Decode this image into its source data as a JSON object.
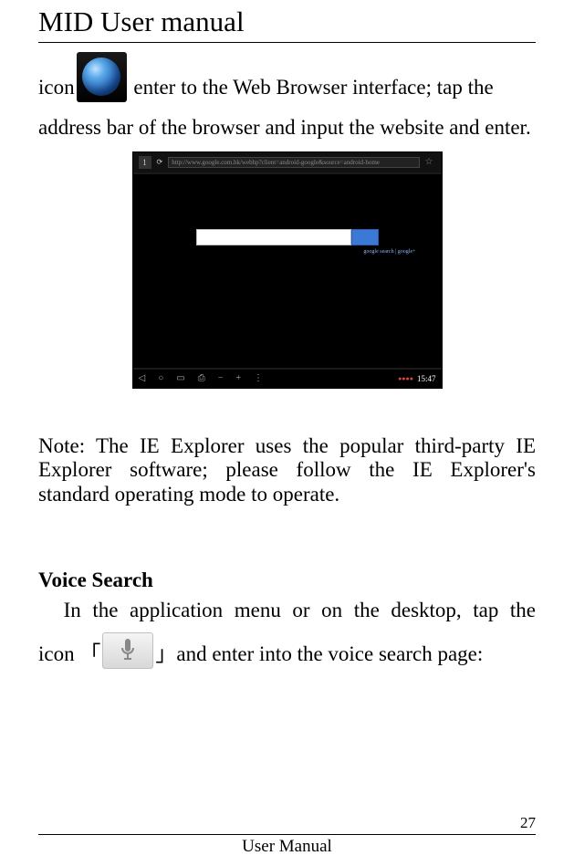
{
  "header": {
    "title": "MID User manual"
  },
  "para1a": "icon",
  "para1b": "enter to the Web Browser interface; tap the",
  "para2": "address bar of the browser and input the website and enter.",
  "screenshot": {
    "url": "http://www.google.com.hk/webhp?client=android-google&source=android-home",
    "hint": "google search  |  google+",
    "time": "15:47",
    "warn": "●●●●"
  },
  "note": "Note: The IE Explorer uses the popular third-party IE Explorer software; please follow the IE Explorer's standard operating mode to operate.",
  "voice": {
    "heading": "Voice Search",
    "line1": "In the application menu or on the desktop, tap the",
    "line2a": "icon 「",
    "line2b": "」and enter into the voice search page:"
  },
  "footer": {
    "page": "27",
    "label": "User Manual"
  }
}
